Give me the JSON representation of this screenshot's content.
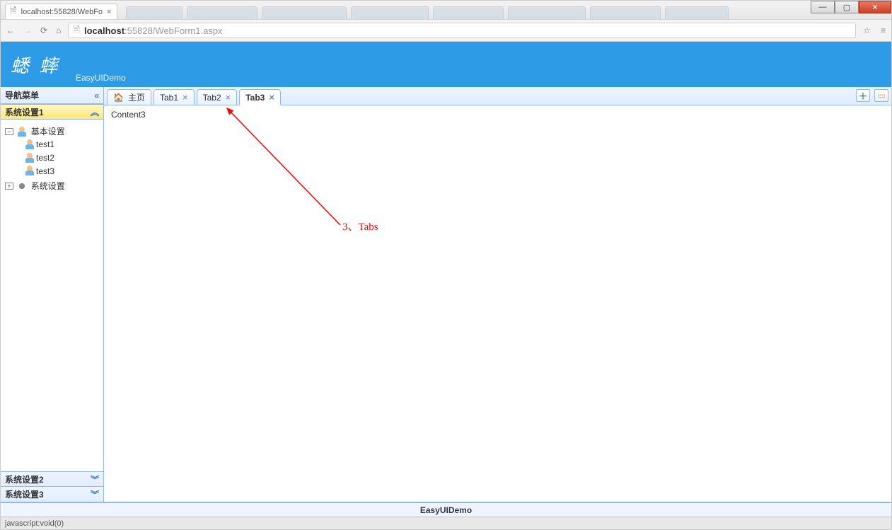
{
  "window": {
    "tab_title": "localhost:55828/WebFo",
    "min_tooltip": "Minimize",
    "max_tooltip": "Maximize",
    "close_tooltip": "Close"
  },
  "navbar": {
    "url_host": "localhost",
    "url_port_path": ":55828/WebForm1.aspx"
  },
  "header": {
    "logo": "蟋 蟀",
    "subtitle": "EasyUIDemo"
  },
  "sidebar": {
    "title": "导航菜单",
    "accordions": [
      {
        "title": "系统设置1",
        "active": true
      },
      {
        "title": "系统设置2",
        "active": false
      },
      {
        "title": "系统设置3",
        "active": false
      }
    ],
    "tree": {
      "root": {
        "label": "基本设置",
        "expanded": true,
        "icon": "person"
      },
      "children": [
        {
          "label": "test1",
          "icon": "person"
        },
        {
          "label": "test2",
          "icon": "person"
        },
        {
          "label": "test3",
          "icon": "person"
        }
      ],
      "sibling": {
        "label": "系统设置",
        "expanded": false,
        "icon": "gear"
      }
    }
  },
  "tabs": {
    "items": [
      {
        "label": "主页",
        "closable": false,
        "home": true,
        "active": false
      },
      {
        "label": "Tab1",
        "closable": true,
        "home": false,
        "active": false
      },
      {
        "label": "Tab2",
        "closable": true,
        "home": false,
        "active": false
      },
      {
        "label": "Tab3",
        "closable": true,
        "home": false,
        "active": true
      }
    ],
    "content": "Content3"
  },
  "annotation": {
    "label": "3、Tabs"
  },
  "footer": {
    "text": "EasyUIDemo"
  },
  "status": {
    "text": "javascript:void(0)"
  }
}
